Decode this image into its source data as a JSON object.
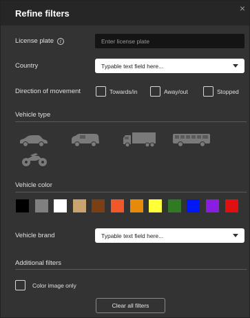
{
  "header": {
    "title": "Refine filters",
    "close_glyph": "×"
  },
  "license_plate": {
    "label": "License plate",
    "info_glyph": "i",
    "placeholder": "Enter license plate"
  },
  "country": {
    "label": "Country",
    "select_value": "Typable text field here..."
  },
  "direction": {
    "label": "Direction of movement",
    "options": [
      {
        "label": "Towards/in",
        "checked": false
      },
      {
        "label": "Away/out",
        "checked": false
      },
      {
        "label": "Stopped",
        "checked": false
      }
    ]
  },
  "vehicle_type": {
    "title": "Vehicle type",
    "types": [
      "car-icon",
      "van-icon",
      "truck-icon",
      "bus-icon",
      "motorcycle-icon"
    ]
  },
  "vehicle_color": {
    "title": "Vehicle color",
    "colors": [
      "#000000",
      "#808080",
      "#ffffff",
      "#c9a46e",
      "#7a3f12",
      "#f0582a",
      "#e68a0a",
      "#ffff3a",
      "#2f7a22",
      "#0018f5",
      "#8a1ee0",
      "#e01010"
    ]
  },
  "vehicle_brand": {
    "label": "Vehicle brand",
    "select_value": "Typable text field here..."
  },
  "additional": {
    "title": "Additional filters",
    "color_image_only": {
      "label": "Color image only",
      "checked": false
    }
  },
  "footer": {
    "clear_label": "Clear all filters"
  },
  "theme": {
    "panel_bg": "#333333",
    "header_bg": "#262626",
    "icon_gray": "#7a7a7a"
  }
}
